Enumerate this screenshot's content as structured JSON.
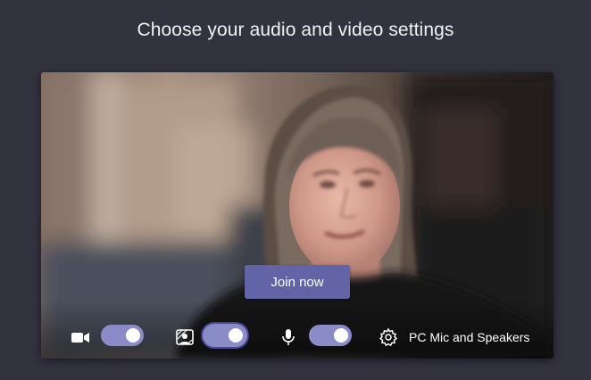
{
  "page": {
    "heading": "Choose your audio and video settings"
  },
  "preview": {
    "join_button_label": "Join now"
  },
  "controls": {
    "camera": {
      "icon": "video-camera-icon",
      "on": true
    },
    "background_effects": {
      "icon": "background-blur-icon",
      "on": true
    },
    "microphone": {
      "icon": "microphone-icon",
      "on": true
    },
    "device_settings_icon": "gear-icon",
    "audio_device_label": "PC Mic and Speakers"
  },
  "colors": {
    "page_background": "#33323f",
    "brand_accent": "#6264a7",
    "toggle_on": "#8b8cc7"
  }
}
